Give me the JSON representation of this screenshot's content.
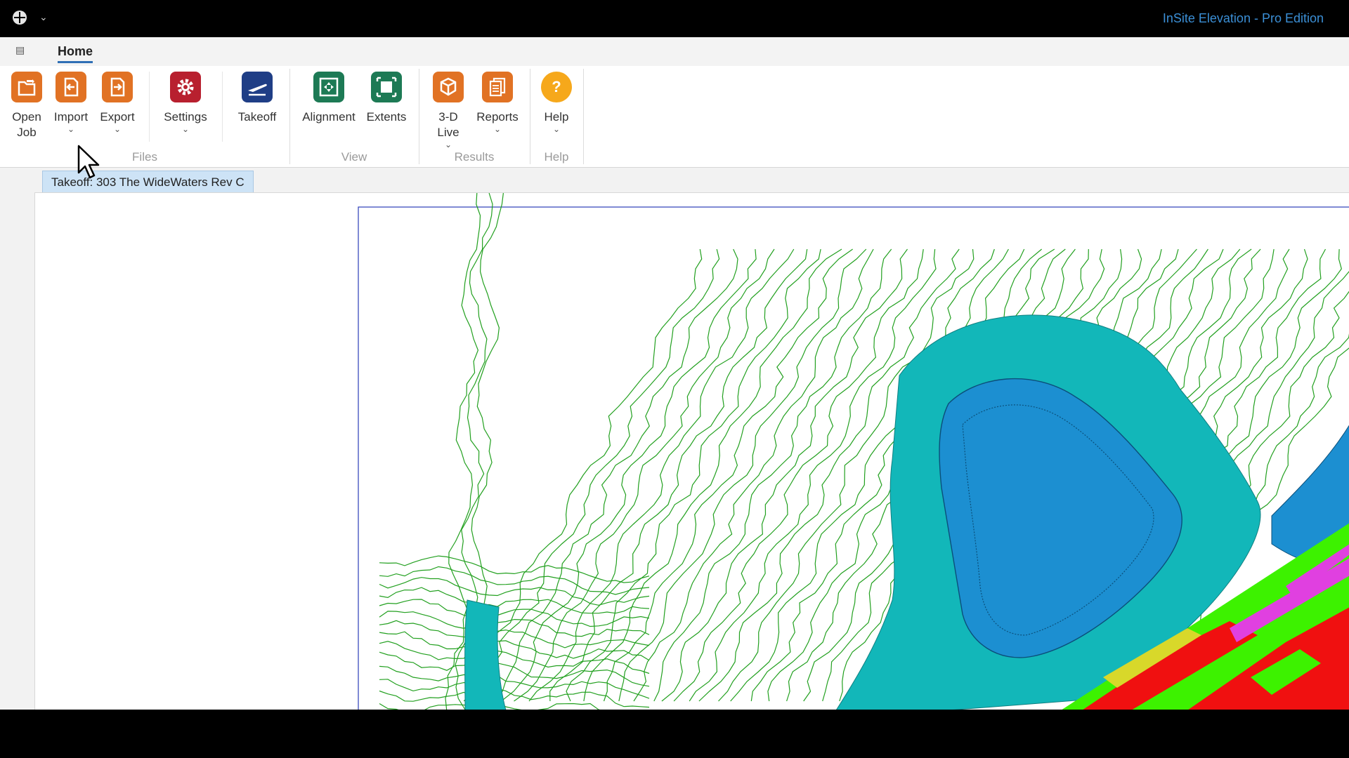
{
  "window": {
    "title": "InSite Elevation - Pro Edition",
    "qat_glyph": "⌄"
  },
  "tabs": {
    "active": "Home",
    "file_menu_glyph": "▤"
  },
  "ribbon": {
    "groups": [
      {
        "label": "Files"
      },
      {
        "label": "View"
      },
      {
        "label": "Results"
      },
      {
        "label": "Help"
      }
    ],
    "buttons": {
      "open_job": {
        "line1": "Open",
        "line2": "Job"
      },
      "import": {
        "label": "Import"
      },
      "export": {
        "label": "Export"
      },
      "settings": {
        "label": "Settings"
      },
      "takeoff": {
        "label": "Takeoff"
      },
      "alignment": {
        "label": "Alignment"
      },
      "extents": {
        "label": "Extents"
      },
      "live3d": {
        "line1": "3-D",
        "line2": "Live"
      },
      "reports": {
        "label": "Reports"
      },
      "help": {
        "label": "Help",
        "glyph": "?"
      }
    },
    "chevron": "⌄"
  },
  "document": {
    "tab_label": "Takeoff: 303 The WideWaters Rev C"
  },
  "colors": {
    "contour_green": "#22a01f",
    "water_teal": "#12b7b9",
    "water_blue": "#1c8fd1",
    "bright_green": "#3df200",
    "red_fill": "#f01010",
    "magenta": "#e040e0",
    "yellow": "#d8d82a",
    "accent_blue": "#3b8fd6"
  },
  "icons": [
    "app-logo-icon",
    "folder-open-icon",
    "import-icon",
    "export-icon",
    "gear-icon",
    "takeoff-plane-icon",
    "alignment-icon",
    "extents-icon",
    "cube-3d-icon",
    "reports-icon",
    "help-icon",
    "mouse-cursor-icon"
  ]
}
